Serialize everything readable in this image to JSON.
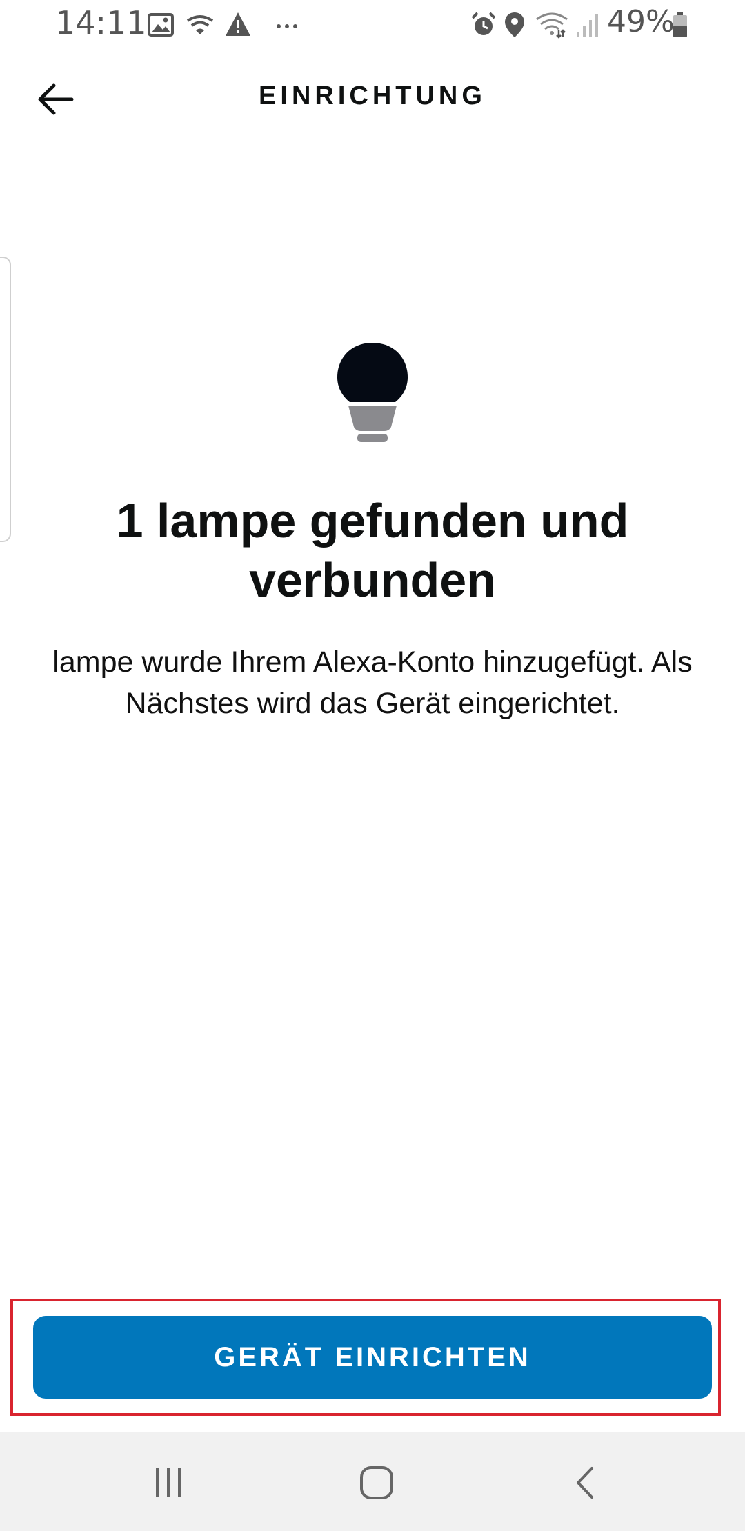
{
  "status_bar": {
    "time": "14:11",
    "battery_percent": "49%",
    "icons": [
      "image-icon",
      "wifi-calling-icon",
      "warning-icon",
      "more-icon",
      "alarm-icon",
      "location-icon",
      "wifi-icon",
      "signal-icon",
      "battery-icon"
    ]
  },
  "header": {
    "title": "EINRICHTUNG",
    "back_icon": "back-arrow-icon"
  },
  "main": {
    "icon": "lightbulb-icon",
    "title": "1 lampe gefunden und verbunden",
    "description": "lampe wurde Ihrem Alexa-Konto hinzugefügt. Als Nächstes wird das Gerät eingerichtet."
  },
  "cta": {
    "label": "GERÄT EINRICHTEN"
  },
  "nav_bar": {
    "icons": [
      "recent-apps-icon",
      "home-icon",
      "back-icon"
    ]
  },
  "colors": {
    "cta_background": "#0177bb",
    "cta_text": "#ffffff",
    "highlight_border": "#d9242f",
    "bulb_top": "#050a14",
    "bulb_base": "#8a8a8e",
    "nav_background": "#f1f1f1"
  }
}
